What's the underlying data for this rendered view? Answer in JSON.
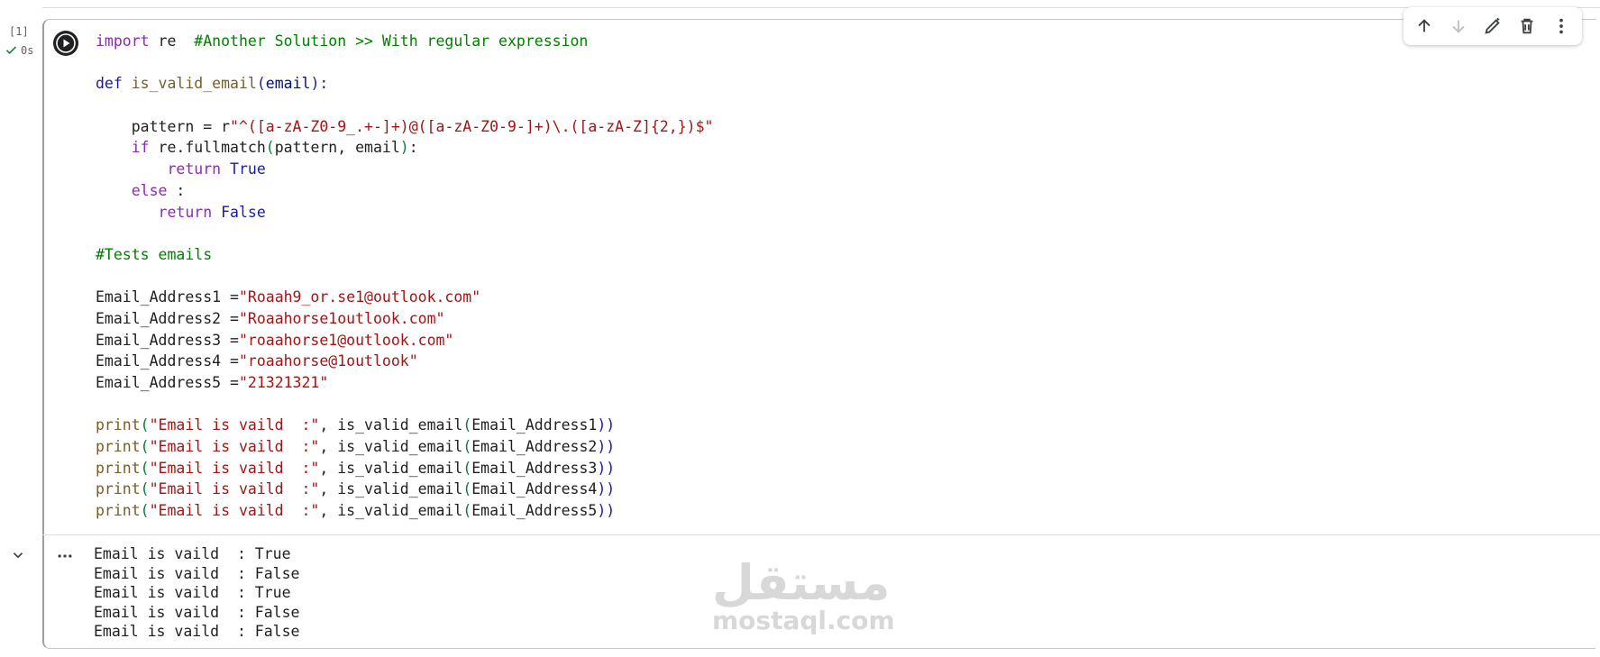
{
  "cell": {
    "execution_count": "[1]",
    "execution_time": "0s",
    "code_lines": [
      [
        {
          "t": "import",
          "c": "kw"
        },
        {
          "t": " re  "
        },
        {
          "t": "#Another Solution >> With regular expression",
          "c": "com"
        }
      ],
      [],
      [
        {
          "t": "def",
          "c": "def"
        },
        {
          "t": " "
        },
        {
          "t": "is_valid_email",
          "c": "fn"
        },
        {
          "t": "(",
          "c": "par"
        },
        {
          "t": "email",
          "c": "var"
        },
        {
          "t": "):",
          "c": "par"
        }
      ],
      [],
      [
        {
          "t": "    pattern = r"
        },
        {
          "t": "\"^([a-zA-Z0-9_.+-]+)@([a-zA-Z0-9-]+)\\.([a-zA-Z]{2,})$\"",
          "c": "str"
        }
      ],
      [
        {
          "t": "    "
        },
        {
          "t": "if",
          "c": "kw"
        },
        {
          "t": " re.fullmatch"
        },
        {
          "t": "(",
          "c": "parg"
        },
        {
          "t": "pattern, email"
        },
        {
          "t": ")",
          "c": "parg"
        },
        {
          "t": ":"
        }
      ],
      [
        {
          "t": "        "
        },
        {
          "t": "return",
          "c": "kw"
        },
        {
          "t": " "
        },
        {
          "t": "True",
          "c": "def"
        }
      ],
      [
        {
          "t": "    "
        },
        {
          "t": "else",
          "c": "kw"
        },
        {
          "t": " :"
        }
      ],
      [
        {
          "t": "       "
        },
        {
          "t": "return",
          "c": "kw"
        },
        {
          "t": " "
        },
        {
          "t": "False",
          "c": "def"
        }
      ],
      [],
      [
        {
          "t": "#Tests emails",
          "c": "com"
        }
      ],
      [],
      [
        {
          "t": "Email_Address1 ="
        },
        {
          "t": "\"Roaah9_or.se1@outlook.com\"",
          "c": "str"
        }
      ],
      [
        {
          "t": "Email_Address2 ="
        },
        {
          "t": "\"Roaahorse1outlook.com\"",
          "c": "str"
        }
      ],
      [
        {
          "t": "Email_Address3 ="
        },
        {
          "t": "\"roaahorse1@outlook.com\"",
          "c": "str"
        }
      ],
      [
        {
          "t": "Email_Address4 ="
        },
        {
          "t": "\"roaahorse@1outlook\"",
          "c": "str"
        }
      ],
      [
        {
          "t": "Email_Address5 ="
        },
        {
          "t": "\"21321321\"",
          "c": "str"
        }
      ],
      [],
      [
        {
          "t": "print",
          "c": "fn"
        },
        {
          "t": "(",
          "c": "parg"
        },
        {
          "t": "\"Email is vaild  :\"",
          "c": "str"
        },
        {
          "t": ", is_valid_email"
        },
        {
          "t": "(",
          "c": "parg"
        },
        {
          "t": "Email_Address1"
        },
        {
          "t": "))",
          "c": "par"
        }
      ],
      [
        {
          "t": "print",
          "c": "fn"
        },
        {
          "t": "(",
          "c": "parg"
        },
        {
          "t": "\"Email is vaild  :\"",
          "c": "str"
        },
        {
          "t": ", is_valid_email"
        },
        {
          "t": "(",
          "c": "parg"
        },
        {
          "t": "Email_Address2"
        },
        {
          "t": "))",
          "c": "par"
        }
      ],
      [
        {
          "t": "print",
          "c": "fn"
        },
        {
          "t": "(",
          "c": "parg"
        },
        {
          "t": "\"Email is vaild  :\"",
          "c": "str"
        },
        {
          "t": ", is_valid_email"
        },
        {
          "t": "(",
          "c": "parg"
        },
        {
          "t": "Email_Address3"
        },
        {
          "t": "))",
          "c": "par"
        }
      ],
      [
        {
          "t": "print",
          "c": "fn"
        },
        {
          "t": "(",
          "c": "parg"
        },
        {
          "t": "\"Email is vaild  :\"",
          "c": "str"
        },
        {
          "t": ", is_valid_email"
        },
        {
          "t": "(",
          "c": "parg"
        },
        {
          "t": "Email_Address4"
        },
        {
          "t": "))",
          "c": "par"
        }
      ],
      [
        {
          "t": "print",
          "c": "fn"
        },
        {
          "t": "(",
          "c": "parg"
        },
        {
          "t": "\"Email is vaild  :\"",
          "c": "str"
        },
        {
          "t": ", is_valid_email"
        },
        {
          "t": "(",
          "c": "parg"
        },
        {
          "t": "Email_Address5"
        },
        {
          "t": "))",
          "c": "par"
        }
      ]
    ],
    "output_lines": [
      "Email is vaild  : True",
      "Email is vaild  : False",
      "Email is vaild  : True",
      "Email is vaild  : False",
      "Email is vaild  : False"
    ]
  },
  "toolbar": {
    "icons": [
      "arrow-up-icon",
      "arrow-down-icon",
      "edit-pencil-icon",
      "trash-icon",
      "more-vert-icon"
    ]
  },
  "watermark": {
    "arabic": "مستقل",
    "latin": "mostaql.com"
  }
}
